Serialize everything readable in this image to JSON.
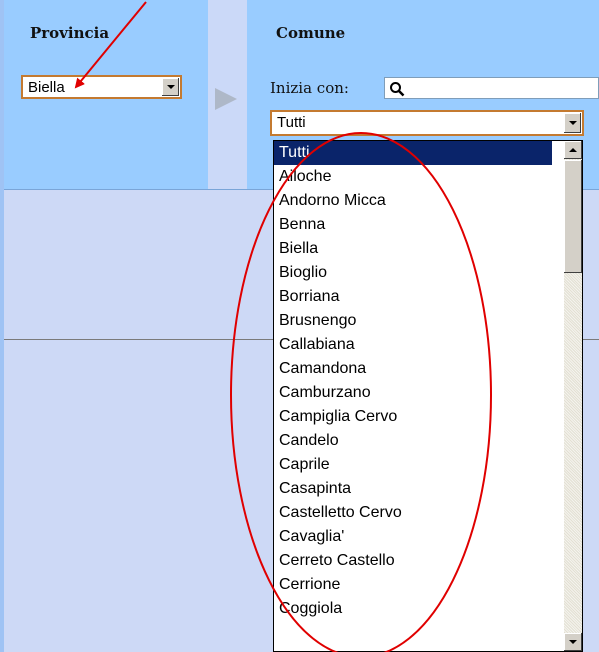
{
  "provincia": {
    "header": "Provincia",
    "selected": "Biella"
  },
  "comune": {
    "header": "Comune",
    "search_label": "Inizia con:",
    "search_value": "",
    "selected": "Tutti",
    "options": [
      "Tutti",
      "Ailoche",
      "Andorno Micca",
      "Benna",
      "Biella",
      "Bioglio",
      "Borriana",
      "Brusnengo",
      "Callabiana",
      "Camandona",
      "Camburzano",
      "Campiglia Cervo",
      "Candelo",
      "Caprile",
      "Casapinta",
      "Castelletto Cervo",
      "Cavaglia'",
      "Cerreto Castello",
      "Cerrione",
      "Coggiola"
    ]
  },
  "colors": {
    "header_band": "#99ccff",
    "page_bg": "#cdd9f6",
    "selection": "#0a246a",
    "annotation": "#e00000"
  },
  "icons": {
    "search": "magnifier-icon",
    "arrow": "play-arrow-icon"
  }
}
